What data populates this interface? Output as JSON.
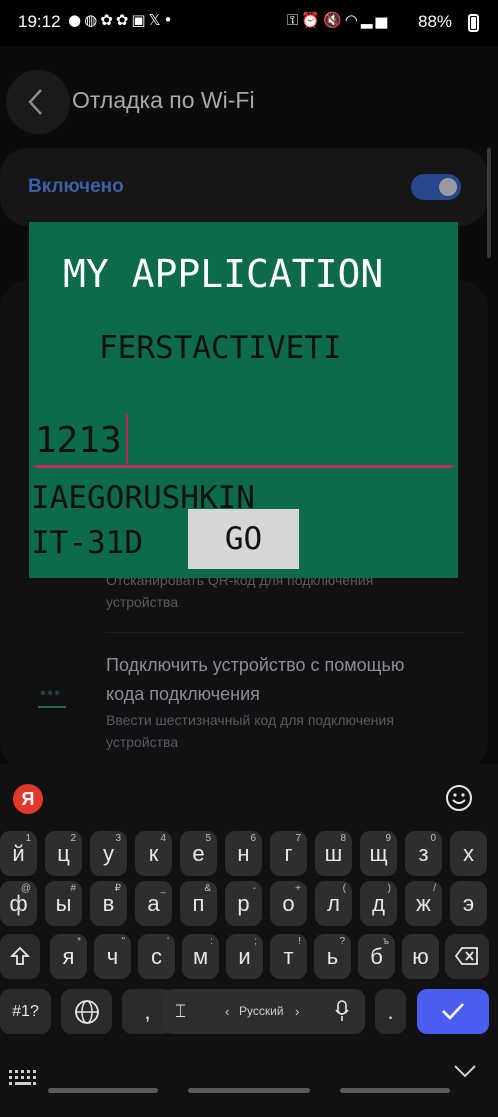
{
  "status_bar": {
    "time": "19:12",
    "battery": "88%",
    "left_icons": [
      "message-icon",
      "hedgehog-icon",
      "clover-icon",
      "clover-icon",
      "ok-icon",
      "x-icon",
      "dot-icon"
    ],
    "right_icons": [
      "key-icon",
      "alarm-icon",
      "mute-icon",
      "wifi-icon",
      "signal-icon",
      "signal-icon"
    ]
  },
  "settings": {
    "title": "Отладка по Wi-Fi",
    "toggle_label": "Включено",
    "toggle_on": true,
    "qr_sub": "Отсканировать QR-код для подключения устройства",
    "pair_title": "Подключить устройство с помощью кода подключения",
    "pair_sub": "Ввести шестизначный код для подключения устройства"
  },
  "app": {
    "title": "MY APPLICATION",
    "subtitle": "FERSTACTIVETI",
    "input_value": "1213",
    "name": "IAEGORUSHKIN",
    "group": "IT-31D",
    "go_label": "GO"
  },
  "keyboard": {
    "row1": [
      {
        "k": "й",
        "h": "1"
      },
      {
        "k": "ц",
        "h": "2"
      },
      {
        "k": "у",
        "h": "3"
      },
      {
        "k": "к",
        "h": "4"
      },
      {
        "k": "е",
        "h": "5"
      },
      {
        "k": "н",
        "h": "6"
      },
      {
        "k": "г",
        "h": "7"
      },
      {
        "k": "ш",
        "h": "8"
      },
      {
        "k": "щ",
        "h": "9"
      },
      {
        "k": "з",
        "h": "0"
      },
      {
        "k": "х",
        "h": ""
      }
    ],
    "row2": [
      {
        "k": "ф",
        "h": "@"
      },
      {
        "k": "ы",
        "h": "#"
      },
      {
        "k": "в",
        "h": "₽"
      },
      {
        "k": "а",
        "h": "_"
      },
      {
        "k": "п",
        "h": "&"
      },
      {
        "k": "р",
        "h": "-"
      },
      {
        "k": "о",
        "h": "+"
      },
      {
        "k": "л",
        "h": "("
      },
      {
        "k": "д",
        "h": ")"
      },
      {
        "k": "ж",
        "h": "/"
      },
      {
        "k": "э",
        "h": ""
      }
    ],
    "row3": [
      {
        "k": "я",
        "h": "*"
      },
      {
        "k": "ч",
        "h": "\""
      },
      {
        "k": "с",
        "h": "'"
      },
      {
        "k": "м",
        "h": ":"
      },
      {
        "k": "и",
        "h": ";"
      },
      {
        "k": "т",
        "h": "!"
      },
      {
        "k": "ь",
        "h": "?"
      },
      {
        "k": "б",
        "h": "ъ"
      },
      {
        "k": "ю",
        "h": ""
      }
    ],
    "symbols_label": "#1?",
    "comma": ",",
    "period": ".",
    "space_label": "Русский",
    "space_arrows_left": "‹",
    "space_arrows_right": "›"
  },
  "colors": {
    "app_bg": "#0d6b4a",
    "accent_underline": "#c2285b",
    "enter_key": "#4a5ef0",
    "yandex": "#e2382a"
  }
}
